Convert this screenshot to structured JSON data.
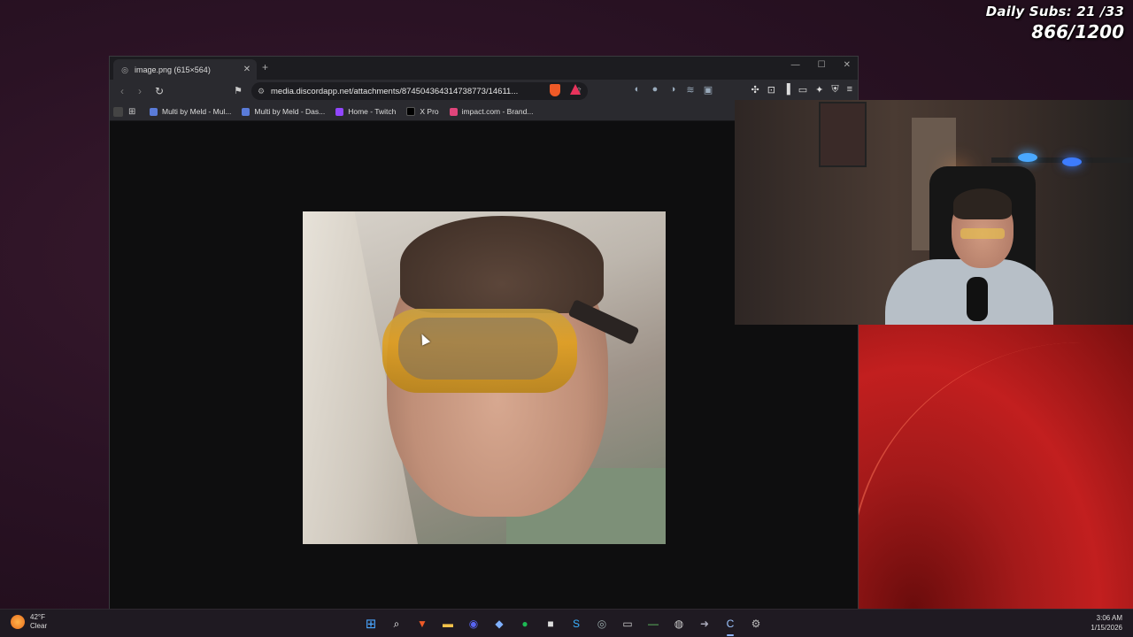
{
  "overlay": {
    "daily_subs": "Daily Subs: 21 /33",
    "sub_goal": "866/1200"
  },
  "browser": {
    "tab_title": "image.png (615×564)",
    "url": "media.discordapp.net/attachments/874504364314738773/14611...",
    "bookmarks": [
      {
        "label": "Multi by Meld - Mul...",
        "color": "#5a7bd8"
      },
      {
        "label": "Multi by Meld - Das...",
        "color": "#5a7bd8"
      },
      {
        "label": "Home - Twitch",
        "color": "#9146ff"
      },
      {
        "label": "X Pro",
        "color": "#000000"
      },
      {
        "label": "impact.com - Brand...",
        "color": "#e0457b"
      }
    ]
  },
  "taskbar": {
    "temperature": "42°F",
    "condition": "Clear",
    "time": "3:06 AM",
    "date": "1/15/2026"
  },
  "colors": {
    "browser_chrome": "#2a2a2f",
    "page_bg": "#0e0e0f",
    "accent_brave": "#ef5a27"
  }
}
